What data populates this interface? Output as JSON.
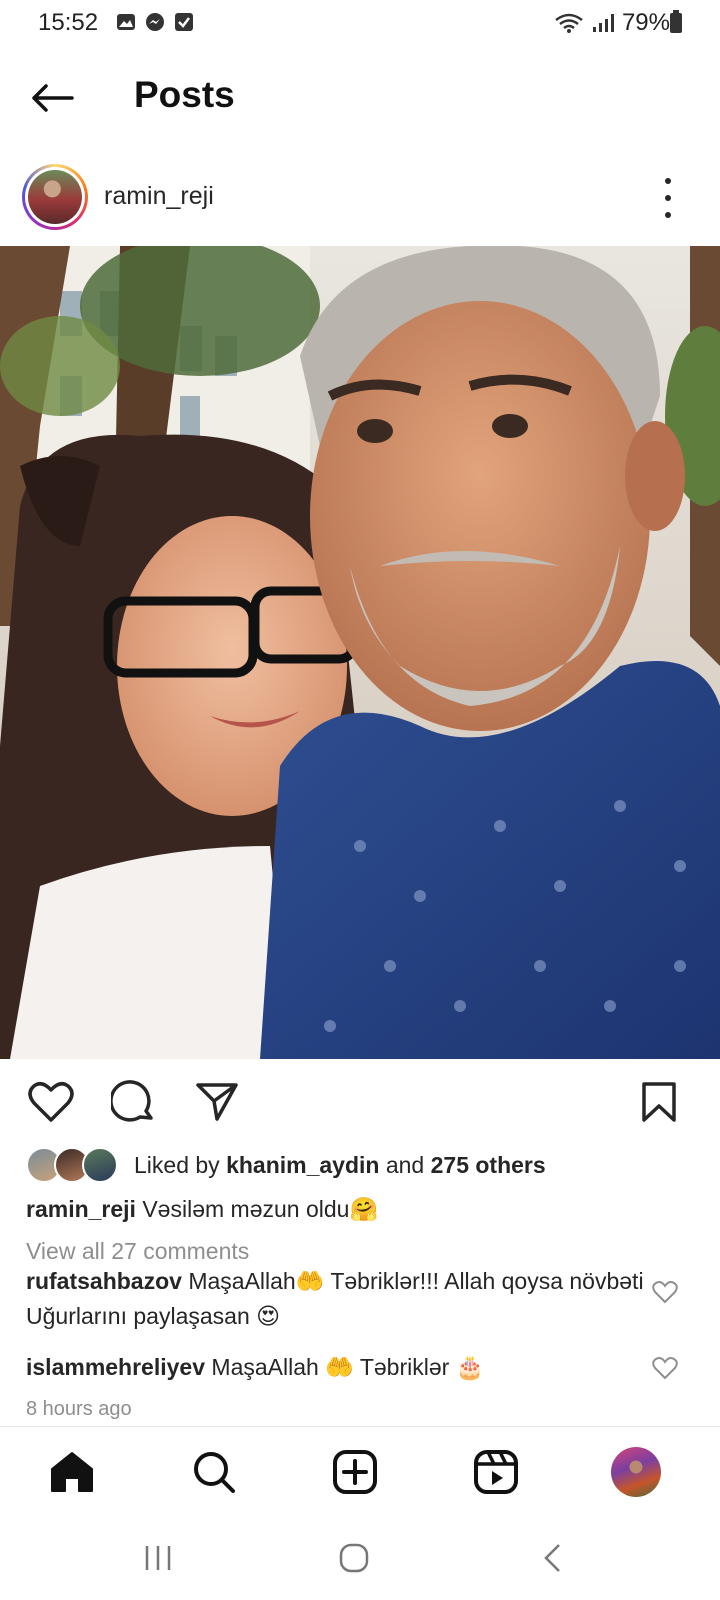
{
  "status_bar": {
    "time": "15:52",
    "battery": "79%",
    "icons": [
      "gallery-icon",
      "messenger-icon",
      "check-icon",
      "wifi-icon",
      "signal-icon",
      "battery-icon"
    ]
  },
  "header": {
    "title": "Posts"
  },
  "post": {
    "username": "ramin_reji",
    "image_alt": "Selfie of a man with grey hair and beard and a young woman with glasses",
    "likes": {
      "prefix": "Liked by",
      "user": "khanim_aydin",
      "middle": "and",
      "others": "275 others"
    },
    "caption": {
      "username": "ramin_reji",
      "text": "Vəsiləm məzun oldu",
      "emoji": "🤗"
    },
    "view_comments": "View all 27 comments",
    "comments": [
      {
        "username": "rufatsahbazov",
        "text1": "MaşaAllah",
        "emoji1": "🤲",
        "text2": "Təbriklər!!! Allah qoysa növbəti Uğurlarını paylaşasan",
        "emoji2": "😍"
      },
      {
        "username": "islammehreliyev",
        "text1": "MaşaAllah",
        "emoji1": "🤲",
        "text2": "Təbriklər",
        "emoji2": "🎂"
      }
    ],
    "time_ago": "8 hours ago"
  },
  "colors": {
    "text": "#262626",
    "muted": "#8e8e8e",
    "border": "#e6e6e6"
  }
}
